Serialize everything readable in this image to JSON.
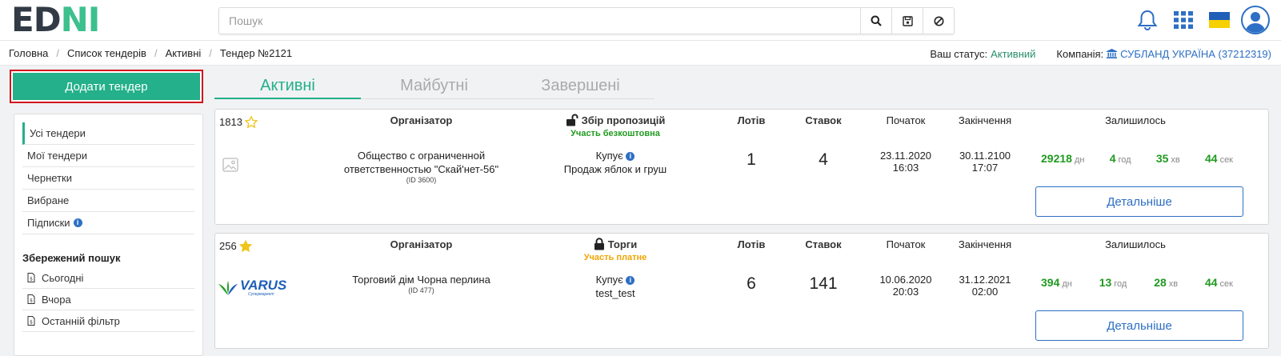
{
  "logo": {
    "part1": "ED",
    "part2": "N",
    "part3": "I"
  },
  "search": {
    "placeholder": "Пошук"
  },
  "breadcrumb": [
    "Головна",
    "Список тендерів",
    "Активні",
    "Тендер №2121"
  ],
  "status": {
    "label": "Ваш статус:",
    "value": "Активний",
    "company_label": "Компанія:",
    "company": "СУБЛАНД УКРАЇНА (37212319)"
  },
  "add_button": "Додати тендер",
  "sidebar": {
    "items": [
      {
        "label": "Усі тендери"
      },
      {
        "label": "Мої тендери"
      },
      {
        "label": "Чернетки"
      },
      {
        "label": "Вибране"
      },
      {
        "label": "Підписки"
      }
    ],
    "saved_header": "Збережений пошук",
    "saved": [
      {
        "label": "Сьогодні"
      },
      {
        "label": "Вчора"
      },
      {
        "label": "Останній фільтр"
      }
    ]
  },
  "tabs": [
    {
      "label": "Активні",
      "active": true
    },
    {
      "label": "Майбутні",
      "active": false
    },
    {
      "label": "Завершені",
      "active": false
    }
  ],
  "columns": {
    "organizer": "Організатор",
    "lots": "Лотів",
    "bids": "Ставок",
    "start": "Початок",
    "end": "Закінчення",
    "remaining": "Залишилось"
  },
  "tenders": [
    {
      "id": "1813",
      "starred": false,
      "org_line1": "Общество с ограниченной",
      "org_line2": "ответственностью \"Скай'нет-56\"",
      "org_id": "(ID 3600)",
      "stage": "Збір пропозицій",
      "participation": "Участь безкоштовна",
      "participation_color": "#1f9a1f",
      "role": "Купує",
      "subject": "Продаж яблок и груш",
      "lots": "1",
      "bids": "4",
      "start": "23.11.2020 16:03",
      "end": "30.11.2100 17:07",
      "days": "29218",
      "days_u": "дн",
      "hours": "4",
      "hours_u": "год",
      "mins": "35",
      "mins_u": "хв",
      "secs": "44",
      "secs_u": "сек",
      "detail": "Детальніше"
    },
    {
      "id": "256",
      "starred": true,
      "org_line1": "Торговий дім Чорна перлина",
      "org_line2": "",
      "org_id": "(ID 477)",
      "stage": "Торги",
      "participation": "Участь платне",
      "participation_color": "#f0a500",
      "role": "Купує",
      "subject": "test_test",
      "lots": "6",
      "bids": "141",
      "start": "10.06.2020 20:03",
      "end": "31.12.2021 02:00",
      "days": "394",
      "days_u": "дн",
      "hours": "13",
      "hours_u": "год",
      "mins": "28",
      "mins_u": "хв",
      "secs": "44",
      "secs_u": "сек",
      "detail": "Детальніше",
      "brand": "VARUS",
      "brand_sub": "Супермаркет"
    }
  ],
  "colors": {
    "accent": "#23b08a",
    "link": "#2d6fc4",
    "countdown": "#1f9a1f"
  }
}
